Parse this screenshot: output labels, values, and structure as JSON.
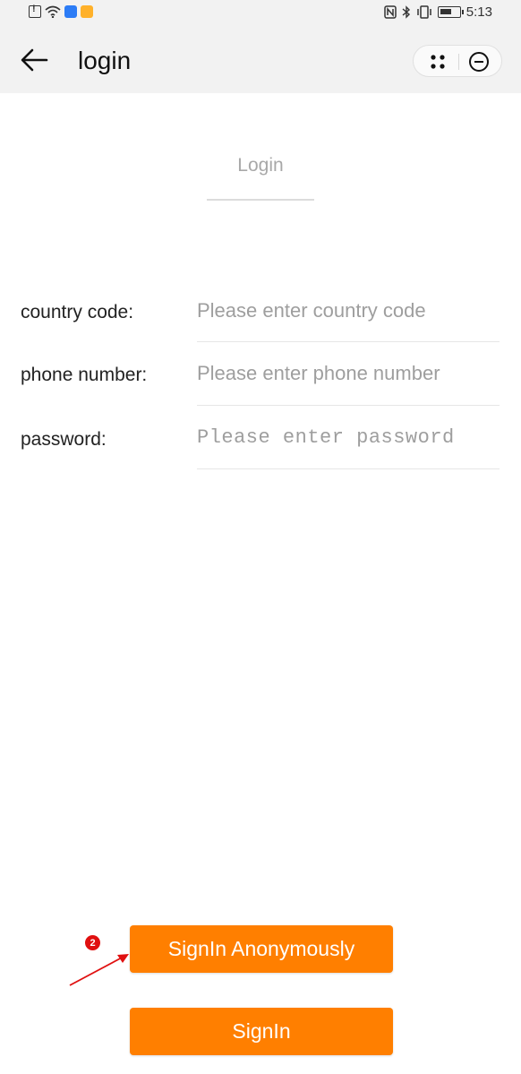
{
  "status_bar": {
    "time": "5:13",
    "icons_left": [
      "sim-alert-icon",
      "wifi-icon",
      "app-blue-icon",
      "app-orange-icon"
    ],
    "icons_right": [
      "nfc-icon",
      "bluetooth-icon",
      "vibrate-icon",
      "battery-icon"
    ]
  },
  "nav": {
    "back_icon": "arrow-left-icon",
    "title": "login",
    "more_icon": "four-dots-icon",
    "close_icon": "minus-circle-icon"
  },
  "tabs": [
    {
      "label": "Login"
    }
  ],
  "form": {
    "country_code": {
      "label": "country code:",
      "placeholder": "Please enter country code",
      "value": ""
    },
    "phone_number": {
      "label": "phone number:",
      "placeholder": "Please enter phone number",
      "value": ""
    },
    "password": {
      "label": "password:",
      "placeholder": "Please enter password",
      "value": ""
    }
  },
  "buttons": {
    "anonymous": "SignIn Anonymously",
    "signin": "SignIn"
  },
  "annotation": {
    "badge": "2"
  },
  "colors": {
    "accent": "#ff7f00",
    "nav_background": "#f2f2f2",
    "annotation": "#e01010"
  }
}
